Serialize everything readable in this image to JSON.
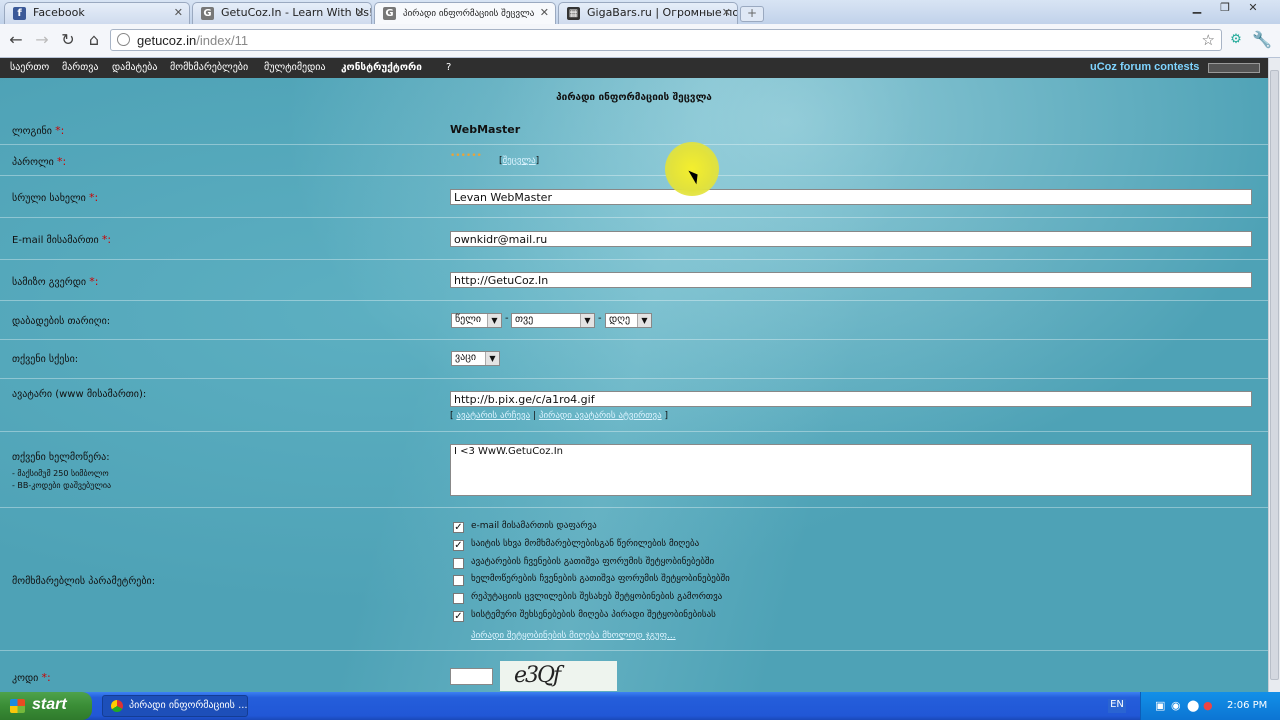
{
  "browser": {
    "tabs": [
      {
        "label": "Facebook",
        "icon": "facebook-icon",
        "active": false
      },
      {
        "label": "GetuCoz.In - Learn With Us!",
        "icon": "getucoz-icon",
        "active": false
      },
      {
        "label": "პირადი ინფორმაციის შეცვლა",
        "icon": "getucoz-icon",
        "active": true
      },
      {
        "label": "GigaBars.ru | Огромные по...",
        "icon": "gigabars-icon",
        "active": false
      }
    ],
    "url_host": "getucoz.in",
    "url_path": "/index/11"
  },
  "topnav": {
    "items": [
      "საერთო",
      "მართვა",
      "დამატება",
      "მომხმარებლები",
      "მულტიმედია",
      "კონსტრუქტორი",
      "?"
    ],
    "right_link": "uCoz forum contests"
  },
  "form": {
    "title": "პირადი ინფორმაციის შეცვლა",
    "required_mark": "*:",
    "login": {
      "label": "ლოგინი",
      "value": "WebMaster"
    },
    "password": {
      "label": "პაროლი",
      "masked": "••••••",
      "change_link": "შეცვლა"
    },
    "fullname": {
      "label": "სრული სახელი",
      "value": "Levan WebMaster"
    },
    "email": {
      "label": "E-mail მისამართი",
      "value": "ownkidr@mail.ru"
    },
    "homepage": {
      "label": "სამიზო გვერდი",
      "value": "http://GetuCoz.In"
    },
    "birthdate": {
      "label": "დაბადების თარიღი:",
      "year": "წელი",
      "month": "თვე",
      "day": "დღე",
      "sep": "-"
    },
    "gender": {
      "label": "თქვენი სქესი:",
      "value": "ვაცი"
    },
    "avatar": {
      "label": "ავატარი (www მისამართი):",
      "value": "http://b.pix.ge/c/a1ro4.gif",
      "link1": "ავატარის არჩევა",
      "link2": "პირადი ავატარის ატვირთვა"
    },
    "signature": {
      "label": "თქვენი ხელმოწერა:",
      "note1": "- მაქსიმუმ 250 სიმბოლო",
      "note2": "- BB-კოდები დაშვებულია",
      "value": "I <3 WwW.GetuCoz.In"
    },
    "options": {
      "label": "მომხმარებლის პარამეტრები:",
      "items": [
        {
          "text": "e-mail მისამართის დაფარვა",
          "checked": true
        },
        {
          "text": "საიტის სხვა მომხმარებლებისგან წერილების მიღება",
          "checked": true
        },
        {
          "text": "ავატარების ჩვენების გათიშვა ფორუმის შეტყობინებებში",
          "checked": false
        },
        {
          "text": "ხელმოწერების ჩვენების გათიშვა ფორუმის შეტყობინებებში",
          "checked": false
        },
        {
          "text": "რეპუტაციის ცვლილების შესახებ შეტყობინების გამორთვა",
          "checked": false
        },
        {
          "text": "სისტემური შეხსენებების მიღება პირადი შეტყობინებისას",
          "checked": true
        }
      ],
      "pm_link": "პირადი შეტყობინების მიღება მხოლოდ ჯგუფ..."
    },
    "captcha": {
      "label": "კოდი",
      "image_text": "e3Qf"
    }
  },
  "taskbar": {
    "start_label": "start",
    "window_item": "პირადი ინფორმაციის ...",
    "lang": "EN",
    "clock": "2:06 PM"
  },
  "colors": {
    "required": "#cc0000",
    "topnav_bg": "#2f2f2f",
    "link_blue": "#7fd4ff"
  }
}
